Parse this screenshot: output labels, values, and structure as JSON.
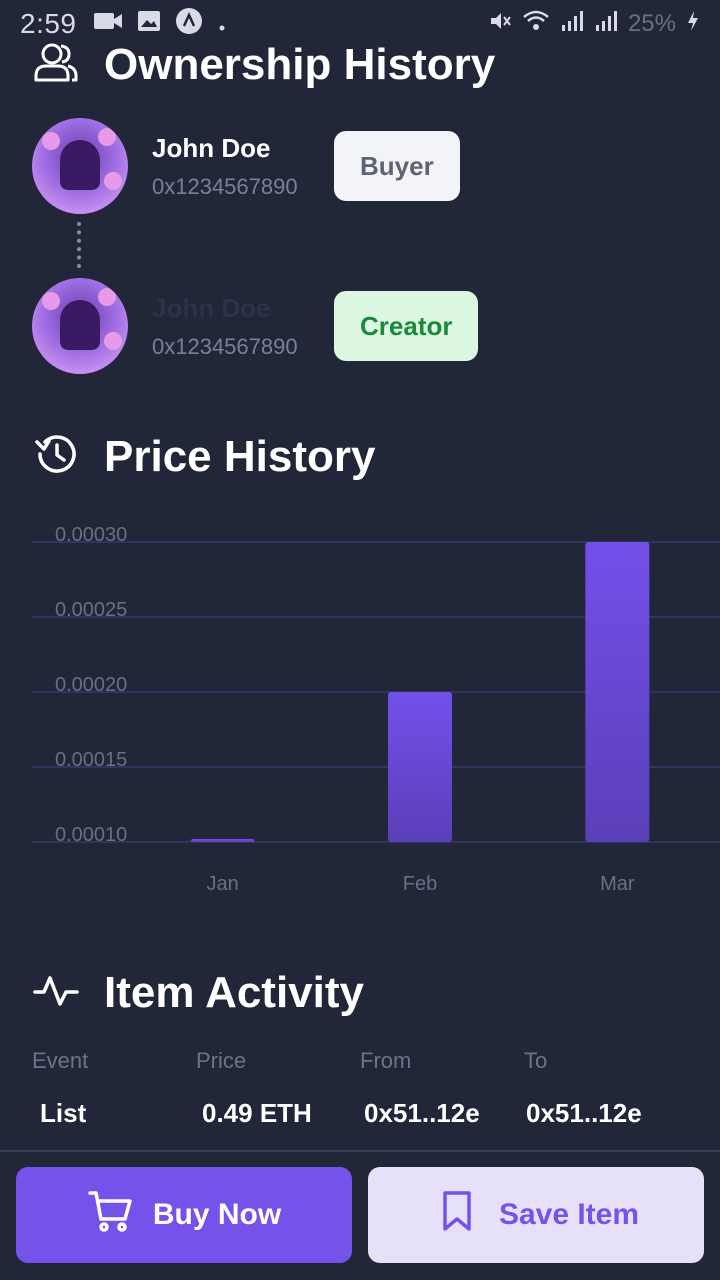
{
  "status_bar": {
    "time": "2:59",
    "battery": "25%",
    "icons": [
      "video-call-icon",
      "image-icon",
      "app-icon",
      "dot-icon",
      "mute-icon",
      "wifi-icon",
      "signal-icon",
      "signal-icon",
      "charging-icon"
    ]
  },
  "ownership": {
    "title": "Ownership History",
    "icon": "users-icon",
    "owners": [
      {
        "name": "John Doe",
        "address": "0x1234567890",
        "role": "Buyer"
      },
      {
        "name": "John Doe",
        "address": "0x1234567890",
        "role": "Creator"
      }
    ]
  },
  "price_history": {
    "title": "Price History",
    "icon": "history-icon"
  },
  "chart_data": {
    "type": "bar",
    "categories": [
      "Jan",
      "Feb",
      "Mar"
    ],
    "values": [
      0.0001,
      0.0002,
      0.0003
    ],
    "ylim": [
      0.0001,
      0.0003
    ],
    "yticks": [
      "0.00010",
      "0.00015",
      "0.00020",
      "0.00025",
      "0.00030"
    ],
    "title": "",
    "xlabel": "",
    "ylabel": "",
    "grid": true,
    "bar_color": "#6e4ee0",
    "grid_color": "#34386a",
    "label_color": "#6b6f82"
  },
  "item_activity": {
    "title": "Item Activity",
    "icon": "activity-icon",
    "columns": [
      "Event",
      "Price",
      "From",
      "To"
    ],
    "rows": [
      {
        "event": "List",
        "price": "0.49 ETH",
        "from": "0x51..12e",
        "to": "0x51..12e"
      }
    ]
  },
  "actions": {
    "buy_label": "Buy Now",
    "save_label": "Save Item",
    "buy_icon": "cart-icon",
    "save_icon": "bookmark-icon"
  },
  "colors": {
    "background": "#222639",
    "accent": "#7552ea",
    "accent_light": "#e6e0fb",
    "buyer_badge": "#f3f4f7",
    "creator_badge": "#dcf8e3",
    "creator_text": "#198a3b"
  }
}
